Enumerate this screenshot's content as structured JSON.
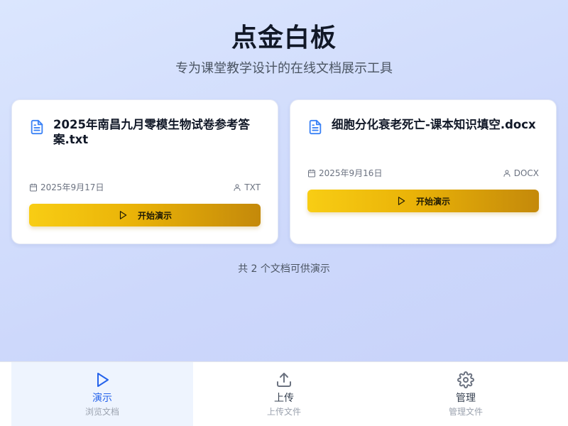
{
  "header": {
    "title": "点金白板",
    "subtitle": "专为课堂教学设计的在线文档展示工具"
  },
  "documents": [
    {
      "name": "2025年南昌九月零模生物试卷参考答案.txt",
      "date": "2025年9月17日",
      "type": "TXT",
      "button_label": "开始演示",
      "icon": "file-text-icon"
    },
    {
      "name": "细胞分化衰老死亡-课本知识填空.docx",
      "date": "2025年9月16日",
      "type": "DOCX",
      "button_label": "开始演示",
      "icon": "file-text-icon"
    }
  ],
  "count_text": "共 2 个文档可供演示",
  "nav": [
    {
      "label": "演示",
      "sub": "浏览文档",
      "icon": "play-icon",
      "active": true
    },
    {
      "label": "上传",
      "sub": "上传文件",
      "icon": "upload-icon",
      "active": false
    },
    {
      "label": "管理",
      "sub": "管理文件",
      "icon": "gear-icon",
      "active": false
    }
  ],
  "colors": {
    "accent": "#2563eb",
    "button_gradient_start": "#f8cd14",
    "button_gradient_end": "#c4890a",
    "doc_icon": "#3b82f6",
    "background": "#d3ddfc"
  }
}
